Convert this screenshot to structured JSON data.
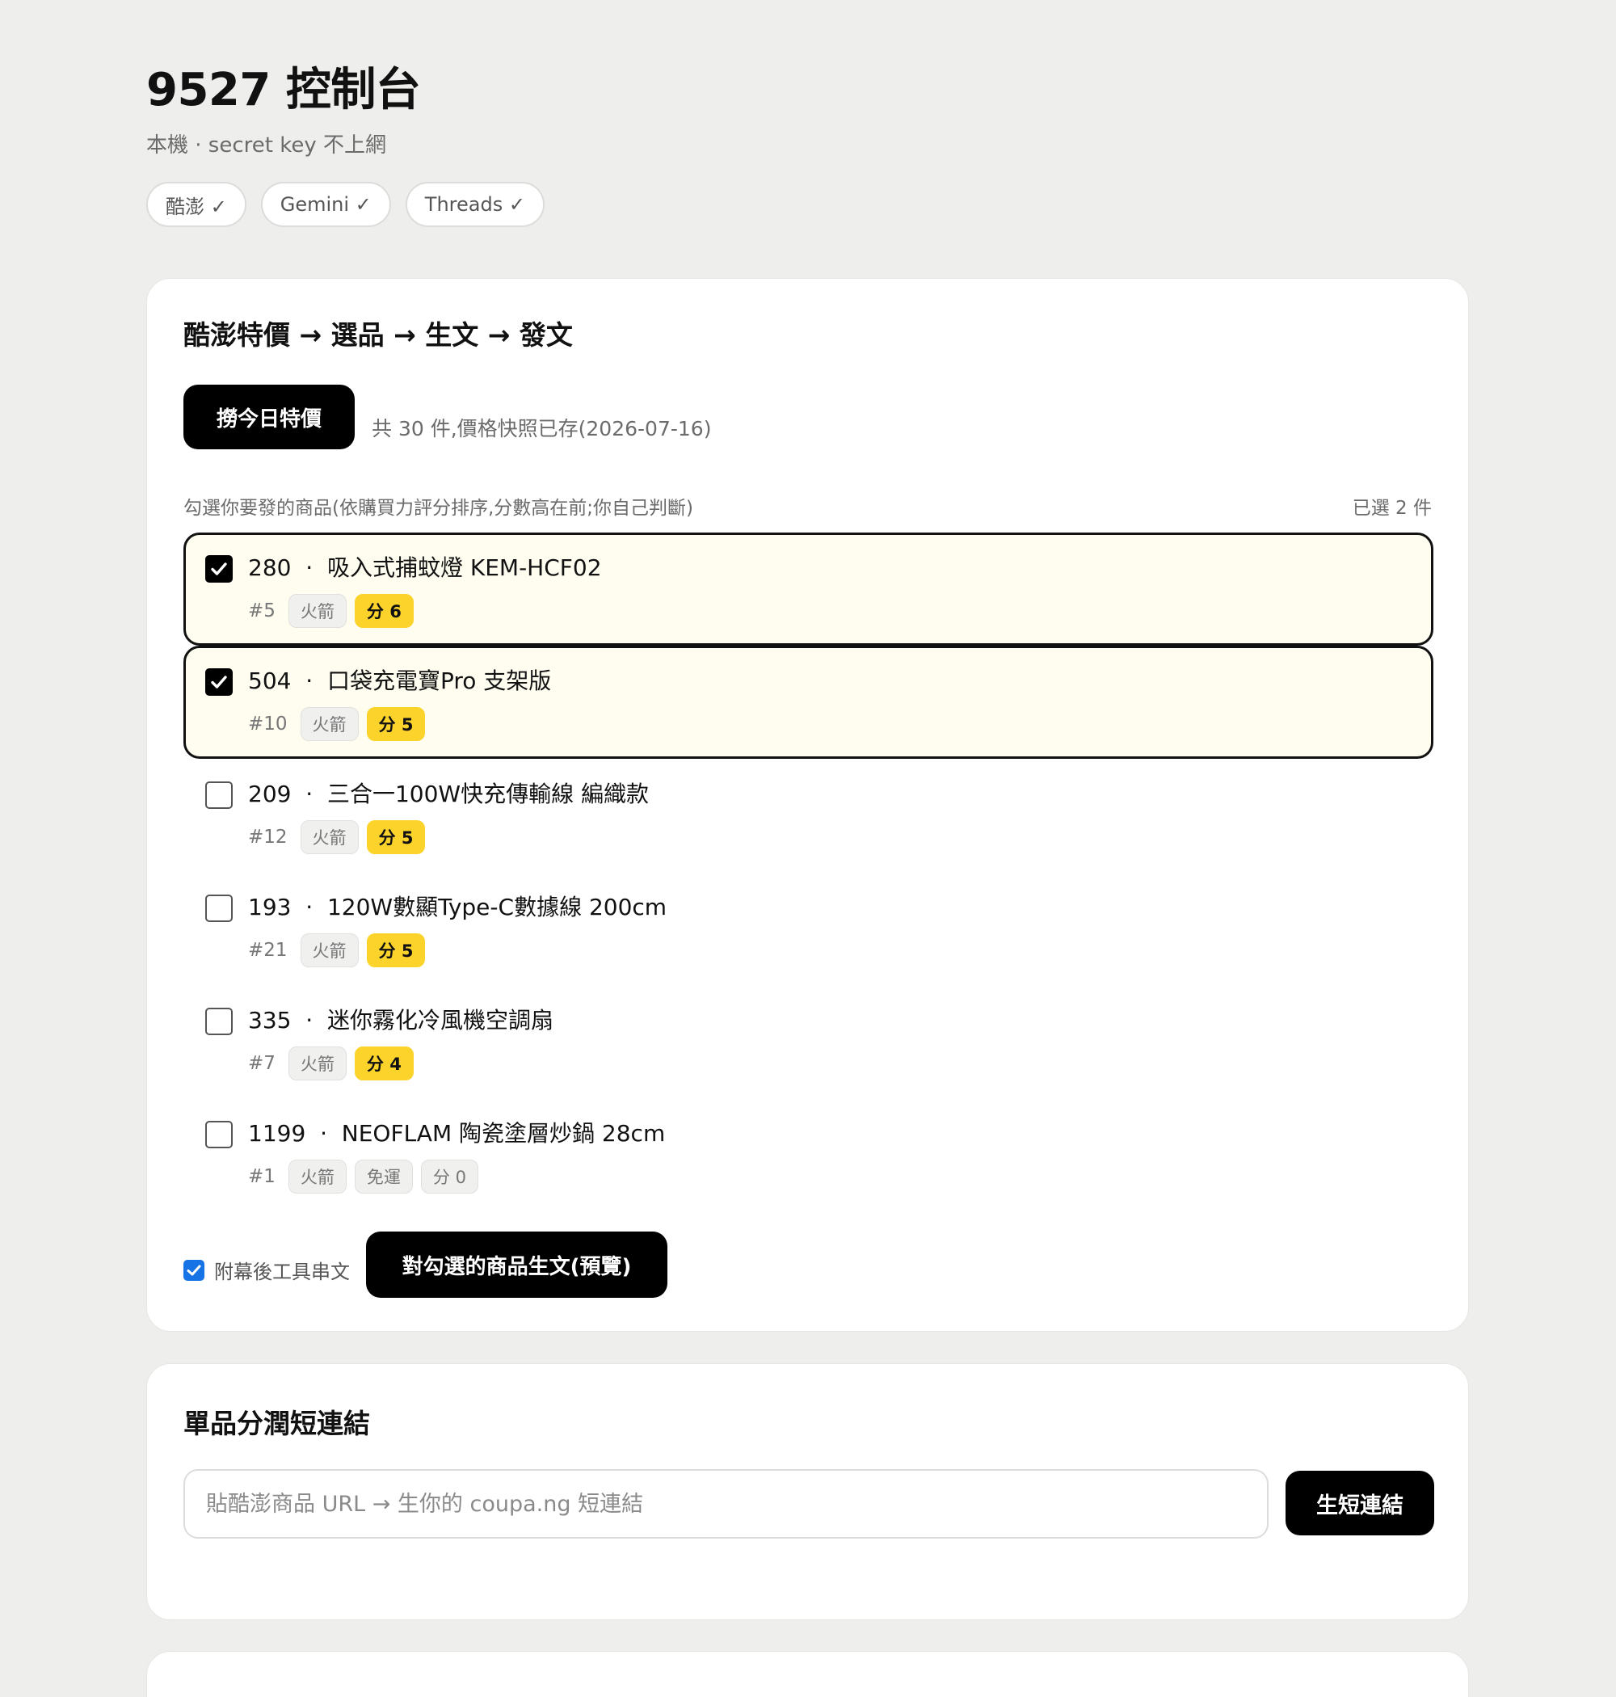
{
  "header": {
    "title": "9527 控制台",
    "subtitle": "本機 · secret key 不上網",
    "chips": [
      "酷澎 ✓",
      "Gemini ✓",
      "Threads ✓"
    ]
  },
  "pipeline": {
    "title": "酷澎特價 → 選品 → 生文 → 發文",
    "fetch_button": "撈今日特價",
    "fetch_info": "共 30 件,價格快照已存(2026-07-16)",
    "list_hint": "勾選你要發的商品(依購買力評分排序,分數高在前;你自己判斷)",
    "selected_count": "已選 2 件",
    "items": [
      {
        "price": "280",
        "name": "吸入式捕蚊燈 KEM-HCF02",
        "rank": "#5",
        "tags": [
          "火箭"
        ],
        "score": "分 6",
        "checked": true
      },
      {
        "price": "504",
        "name": "口袋充電寶Pro 支架版",
        "rank": "#10",
        "tags": [
          "火箭"
        ],
        "score": "分 5",
        "checked": true
      },
      {
        "price": "209",
        "name": "三合一100W快充傳輸線 編織款",
        "rank": "#12",
        "tags": [
          "火箭"
        ],
        "score": "分 5",
        "checked": false
      },
      {
        "price": "193",
        "name": "120W數顯Type-C數據線 200cm",
        "rank": "#21",
        "tags": [
          "火箭"
        ],
        "score": "分 5",
        "checked": false
      },
      {
        "price": "335",
        "name": "迷你霧化冷風機空調扇",
        "rank": "#7",
        "tags": [
          "火箭"
        ],
        "score": "分 4",
        "checked": false
      },
      {
        "price": "1199",
        "name": "NEOFLAM 陶瓷塗層炒鍋 28cm",
        "rank": "#1",
        "tags": [
          "火箭",
          "免運"
        ],
        "score": "分 0",
        "checked": false
      }
    ],
    "attach_label": "附幕後工具串文",
    "attach_checked": true,
    "generate_button": "對勾選的商品生文(預覽)"
  },
  "shortlink": {
    "title": "單品分潤短連結",
    "input_placeholder": "貼酷澎商品 URL → 生你的 coupa.ng 短連結",
    "input_value": "",
    "button": "生短連結"
  },
  "colors": {
    "background": "#eeeeec",
    "accent_yellow": "#fcd32a",
    "checked_row_bg": "#fffdf0",
    "checkbox_blue": "#1673e6"
  },
  "icons": {
    "check": "check-icon"
  }
}
